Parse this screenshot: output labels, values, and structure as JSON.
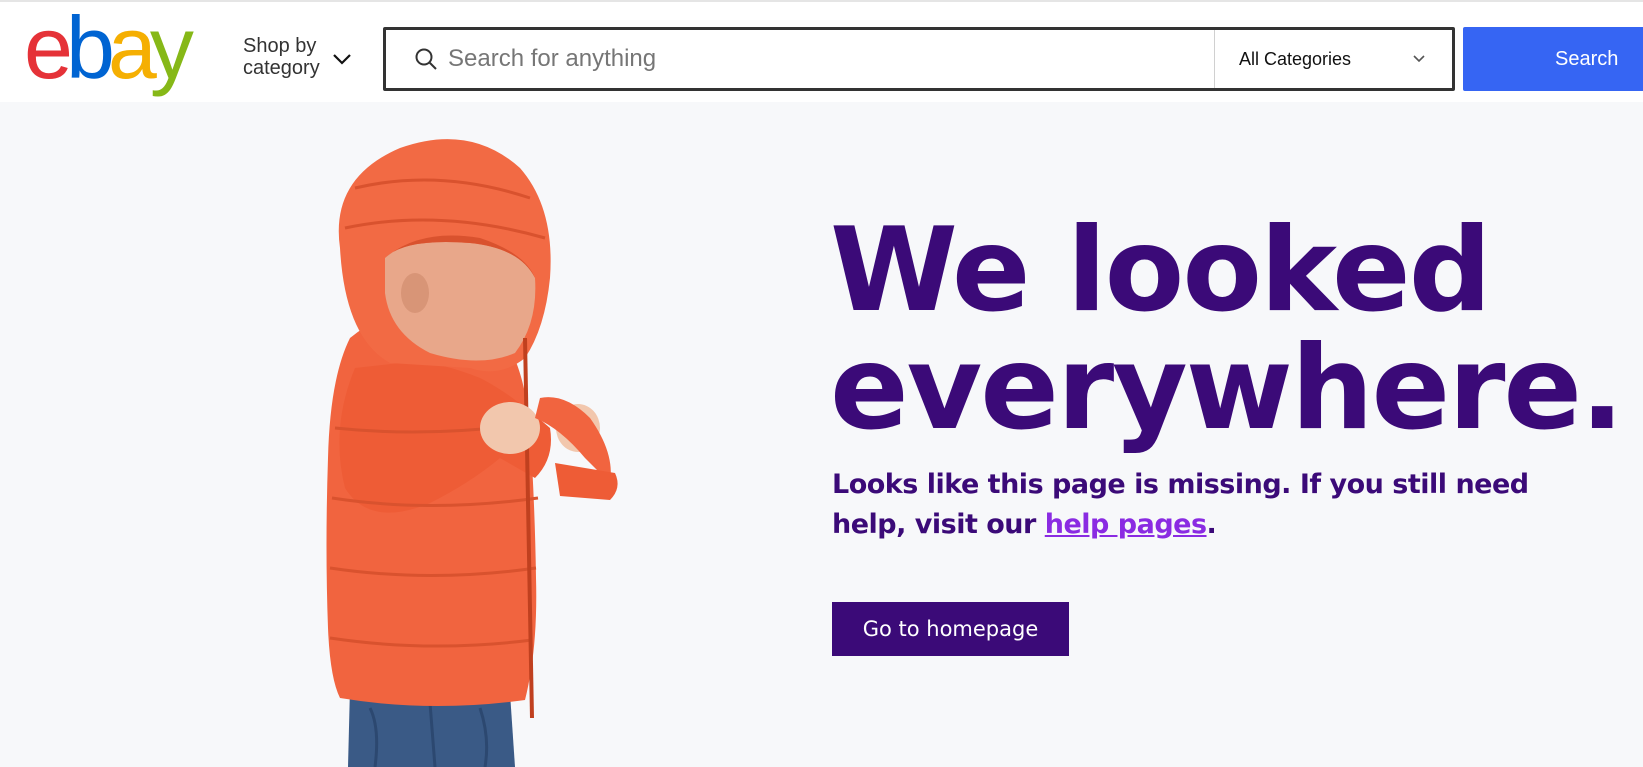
{
  "header": {
    "logo_letters": [
      "e",
      "b",
      "a",
      "y"
    ],
    "logo_colors": [
      "#e53238",
      "#0064d2",
      "#f5af02",
      "#86b817"
    ],
    "shop_by_line1": "Shop by",
    "shop_by_line2": "category",
    "search_placeholder": "Search for anything",
    "category_selected": "All Categories",
    "search_button_label": "Search",
    "search_button_color": "#3665f3"
  },
  "main": {
    "headline_line1": "We looked",
    "headline_line2": "everywhere.",
    "subtext_before_link": "Looks like this page is missing. If you still need help, visit our ",
    "help_link_label": "help pages",
    "subtext_after_link": ".",
    "home_button_label": "Go to homepage",
    "accent_color": "#3b0a78",
    "link_color": "#8a2be2"
  }
}
